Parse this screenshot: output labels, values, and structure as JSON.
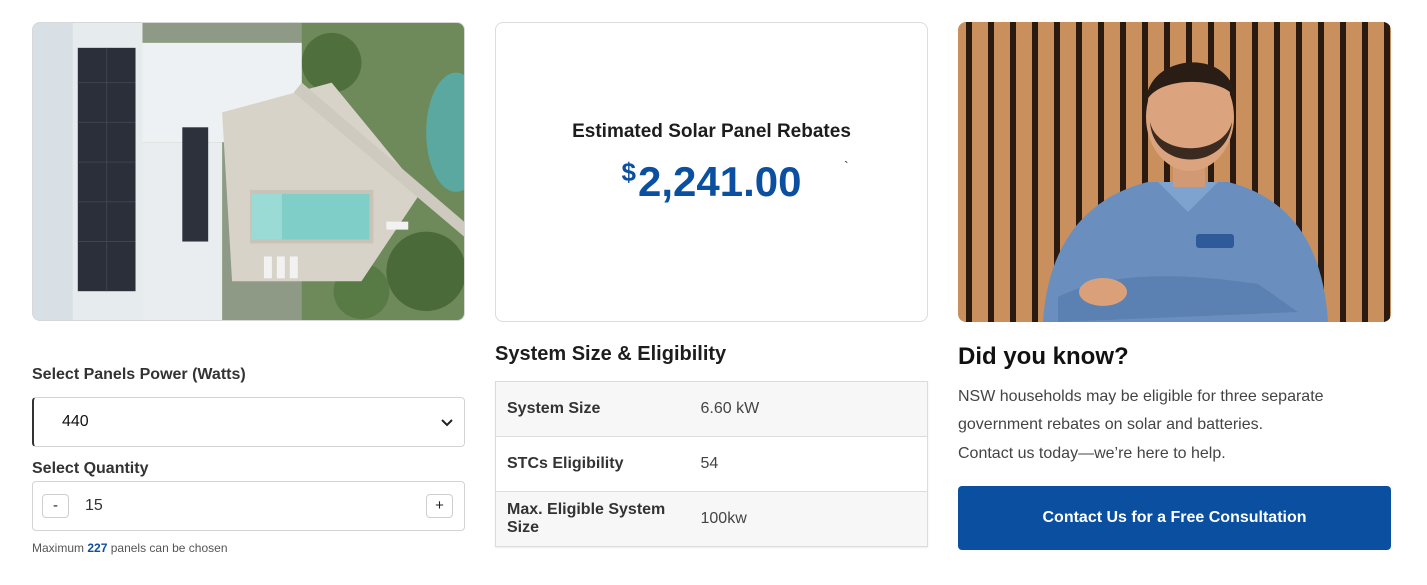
{
  "calculator": {
    "power_label": "Select Panels Power (Watts)",
    "power_selected": "440",
    "quantity_label": "Select Quantity",
    "quantity_value": "15",
    "minus_label": "-",
    "plus_label": "+",
    "hint_prefix": "Maximum",
    "hint_max": "227",
    "hint_suffix": "panels can be chosen"
  },
  "rebate": {
    "title": "Estimated Solar Panel Rebates",
    "currency": "$",
    "amount": "2,241.00",
    "stray_mark": "`"
  },
  "eligibility": {
    "title": "System Size & Eligibility",
    "rows": [
      {
        "label": "System Size",
        "value": "6.60 kW"
      },
      {
        "label": "STCs Eligibility",
        "value": "54"
      },
      {
        "label": "Max. Eligible System Size",
        "value": "100kw"
      }
    ]
  },
  "info": {
    "title": "Did you know?",
    "body": "NSW households may be eligible for three separate government rebates on solar and batteries.",
    "sub": "Contact us today—we’re here to help.",
    "cta_label": "Contact Us for a Free Consultation"
  },
  "colors": {
    "accent": "#0a4fa0",
    "text_dark": "#1d1d1d",
    "border": "#dcdcdc"
  }
}
